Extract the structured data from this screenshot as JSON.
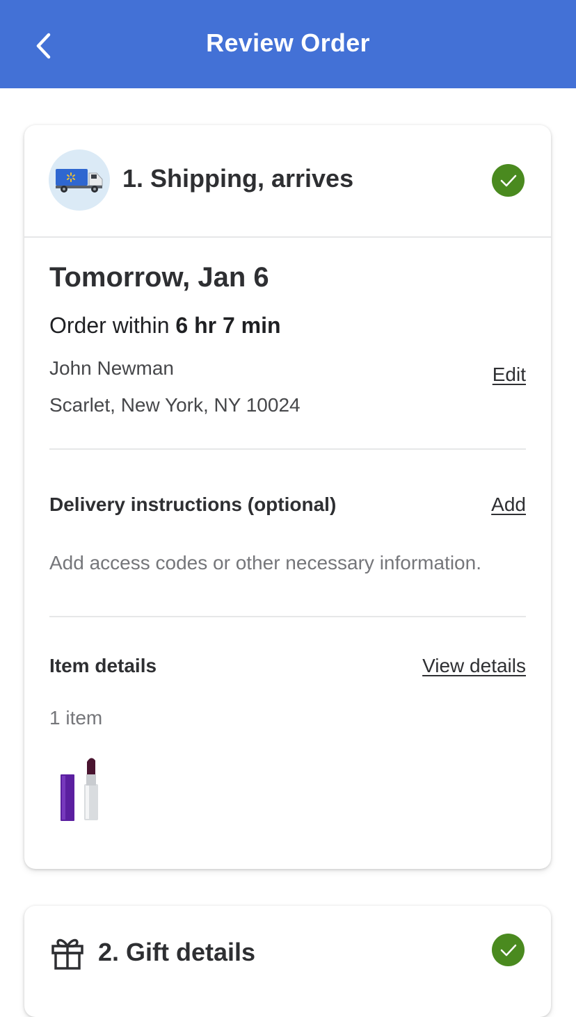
{
  "header": {
    "title": "Review Order",
    "back_icon": "chevron-left-icon",
    "background": "#4371d6"
  },
  "shipping": {
    "step_title": "1. Shipping, arrives",
    "icon": "delivery-truck-icon",
    "status_icon": "check-circle-icon",
    "status_color": "#4a8a1f",
    "date": "Tomorrow, Jan 6",
    "order_within_prefix": "Order within",
    "order_within_time": "6 hr 7 min",
    "recipient_name": "John Newman",
    "address": "Scarlet, New York, NY 10024",
    "edit_label": "Edit"
  },
  "delivery_instructions": {
    "label": "Delivery instructions (optional)",
    "add_label": "Add",
    "hint": "Add access codes or other necessary information."
  },
  "items": {
    "label": "Item details",
    "view_label": "View details",
    "count": "1 item",
    "thumbnail": "lipstick-product-image"
  },
  "gift": {
    "step_title": "2. Gift details",
    "icon": "gift-icon",
    "status_icon": "check-circle-icon"
  }
}
